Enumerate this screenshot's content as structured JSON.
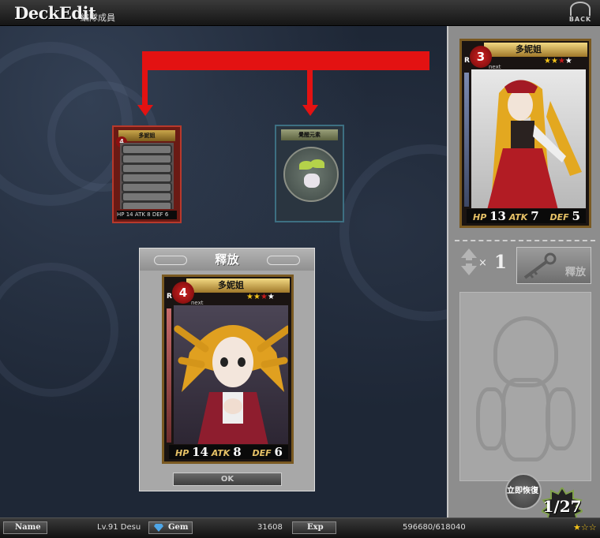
{
  "header": {
    "title": "DeckEdit",
    "subtitle": "編隊成員",
    "back_label": "BACK"
  },
  "slot_cards": [
    {
      "name": "多妮姐",
      "level": "4",
      "stats": "HP 14 ATK 8 DEF 6",
      "state": "locked"
    },
    {
      "name": "覺醒元素"
    }
  ],
  "release_panel": {
    "title": "釋放",
    "ok_label": "OK",
    "card": {
      "rarity": "R",
      "level": "4",
      "name": "多妮姐",
      "next_label": "next",
      "stars_filled": 2,
      "stars_total": 4,
      "hp_label": "HP",
      "hp": "14",
      "atk_label": "ATK",
      "atk": "8",
      "def_label": "DEF",
      "def": "6"
    }
  },
  "right_panel": {
    "card": {
      "rarity": "R",
      "level": "3",
      "name": "多妮姐",
      "next_label": "next",
      "stars_filled": 2,
      "stars_total": 4,
      "hp_label": "HP",
      "hp": "13",
      "atk_label": "ATK",
      "atk": "7",
      "def_label": "DEF",
      "def": "5"
    },
    "count_symbol": "×",
    "count_value": "1",
    "release_button_label": "釋放",
    "instant_restore_label": "立即恢復",
    "deck_count": "1/27"
  },
  "footer": {
    "name_label": "Name",
    "level_text": "Lv.91 Desu",
    "gem_label": "Gem",
    "gem_value": "31608",
    "exp_label": "Exp",
    "exp_value": "596680/618040"
  },
  "colors": {
    "connector_red": "#e31212",
    "star_gold": "#f2c21a",
    "star_red": "#c61c1c",
    "panel_grey": "#8d8d8d"
  }
}
